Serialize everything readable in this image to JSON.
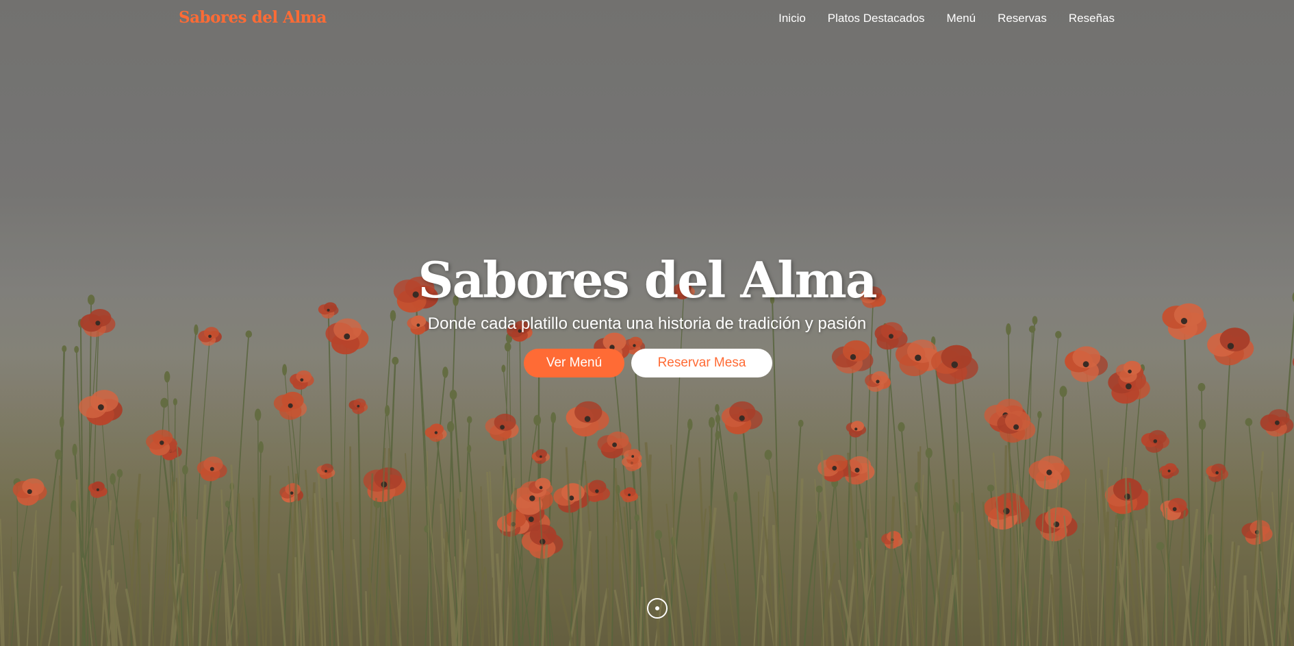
{
  "brand": {
    "name": "Sabores del Alma",
    "color": "#ff6b35"
  },
  "nav": {
    "items": [
      {
        "label": "Inicio"
      },
      {
        "label": "Platos Destacados"
      },
      {
        "label": "Menú"
      },
      {
        "label": "Reservas"
      },
      {
        "label": "Reseñas"
      }
    ]
  },
  "hero": {
    "title": "Sabores del Alma",
    "subtitle": "Donde cada platillo cuenta una historia de tradición y pasión",
    "primary_button": "Ver Menú",
    "secondary_button": "Reservar Mesa",
    "background_image": "poppy-field-photo"
  },
  "scroll": {
    "icon": "scroll-down-icon"
  },
  "colors": {
    "accent": "#ff6b35",
    "text_light": "#ffffff"
  }
}
